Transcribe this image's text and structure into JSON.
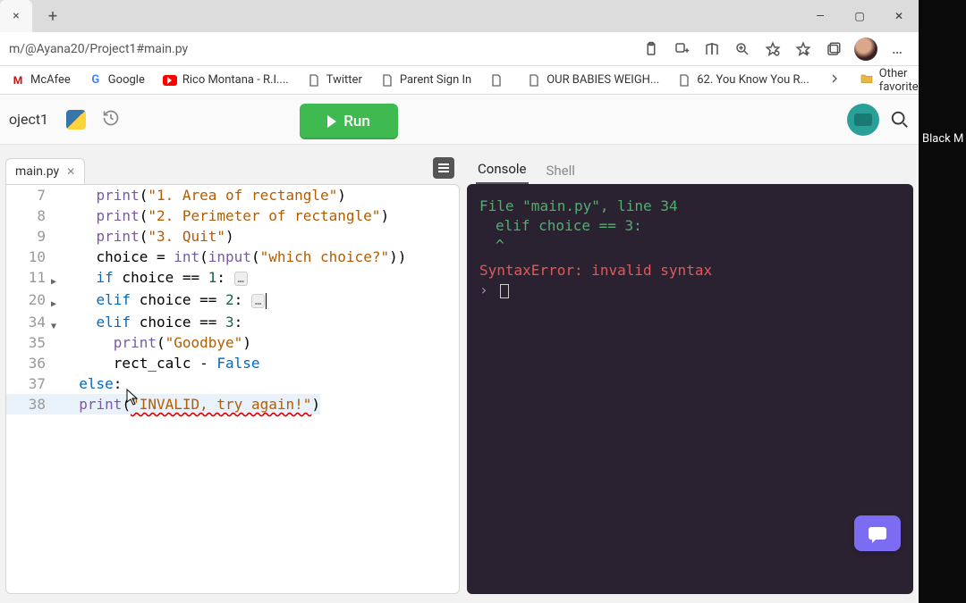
{
  "overlay": {
    "participant_label": "Black M"
  },
  "browser": {
    "close_tab": "×",
    "address": "m/@Ayana20/Project1#main.py",
    "window_controls": {
      "min": "—",
      "max": "▢",
      "close": "✕"
    },
    "addr_icons": {
      "clipboard": "clipboard-icon",
      "add_ext": "extensions-icon",
      "reader": "reader-icon",
      "zoom": "zoom-icon",
      "star": "favorite-star-icon",
      "star_plus": "collections-star-icon",
      "collections": "collections-icon",
      "more": "…"
    }
  },
  "bookmarks": {
    "items": [
      {
        "label": "McAfee",
        "icon": "mcafee"
      },
      {
        "label": "Google",
        "icon": "google"
      },
      {
        "label": "Rico Montana - R.I....",
        "icon": "youtube"
      },
      {
        "label": "Twitter",
        "icon": "page"
      },
      {
        "label": "Parent Sign In",
        "icon": "page"
      },
      {
        "label": "",
        "icon": "page"
      },
      {
        "label": "OUR BABIES WEIGH...",
        "icon": "page"
      },
      {
        "label": "62. You Know You R...",
        "icon": "page"
      }
    ],
    "other_label": "Other favorites"
  },
  "app_bar": {
    "project_name": "oject1",
    "run_label": "Run"
  },
  "editor": {
    "file_tab": "main.py",
    "lines": [
      {
        "num": "7",
        "fold": "",
        "tokens": [
          {
            "t": "    ",
            "c": ""
          },
          {
            "t": "print",
            "c": "fn"
          },
          {
            "t": "(",
            "c": ""
          },
          {
            "t": "\"1. Area of rectangle\"",
            "c": "str"
          },
          {
            "t": ")",
            "c": ""
          }
        ]
      },
      {
        "num": "8",
        "fold": "",
        "tokens": [
          {
            "t": "    ",
            "c": ""
          },
          {
            "t": "print",
            "c": "fn"
          },
          {
            "t": "(",
            "c": ""
          },
          {
            "t": "\"2. Perimeter of rectangle\"",
            "c": "str"
          },
          {
            "t": ")",
            "c": ""
          }
        ]
      },
      {
        "num": "9",
        "fold": "",
        "tokens": [
          {
            "t": "    ",
            "c": ""
          },
          {
            "t": "print",
            "c": "fn"
          },
          {
            "t": "(",
            "c": ""
          },
          {
            "t": "\"3. Quit\"",
            "c": "str"
          },
          {
            "t": ")",
            "c": ""
          }
        ]
      },
      {
        "num": "10",
        "fold": "",
        "tokens": [
          {
            "t": "    ",
            "c": ""
          },
          {
            "t": "choice = ",
            "c": ""
          },
          {
            "t": "int",
            "c": "fn"
          },
          {
            "t": "(",
            "c": ""
          },
          {
            "t": "input",
            "c": "fn"
          },
          {
            "t": "(",
            "c": ""
          },
          {
            "t": "\"which choice?\"",
            "c": "str"
          },
          {
            "t": "))",
            "c": ""
          }
        ]
      },
      {
        "num": "11",
        "fold": "▶",
        "tokens": [
          {
            "t": "    ",
            "c": ""
          },
          {
            "t": "if",
            "c": "kw"
          },
          {
            "t": " choice == ",
            "c": ""
          },
          {
            "t": "1",
            "c": "num"
          },
          {
            "t": ": ",
            "c": ""
          },
          {
            "t": "…",
            "c": "fold-dots"
          }
        ]
      },
      {
        "num": "20",
        "fold": "▶",
        "tokens": [
          {
            "t": "    ",
            "c": ""
          },
          {
            "t": "elif",
            "c": "kw"
          },
          {
            "t": " choice == ",
            "c": ""
          },
          {
            "t": "2",
            "c": "num"
          },
          {
            "t": ": ",
            "c": ""
          },
          {
            "t": "…",
            "c": "fold-dots"
          },
          {
            "t": "",
            "c": "caret"
          }
        ]
      },
      {
        "num": "34",
        "fold": "▼",
        "tokens": [
          {
            "t": "    ",
            "c": ""
          },
          {
            "t": "elif",
            "c": "kw"
          },
          {
            "t": " choice == ",
            "c": ""
          },
          {
            "t": "3",
            "c": "num"
          },
          {
            "t": ":",
            "c": ""
          }
        ]
      },
      {
        "num": "35",
        "fold": "",
        "tokens": [
          {
            "t": "      ",
            "c": ""
          },
          {
            "t": "print",
            "c": "fn"
          },
          {
            "t": "(",
            "c": ""
          },
          {
            "t": "\"Goodbye\"",
            "c": "str"
          },
          {
            "t": ")",
            "c": ""
          }
        ]
      },
      {
        "num": "36",
        "fold": "",
        "tokens": [
          {
            "t": "      rect_calc - ",
            "c": ""
          },
          {
            "t": "False",
            "c": "bool"
          }
        ]
      },
      {
        "num": "37",
        "fold": "",
        "tokens": [
          {
            "t": "  ",
            "c": ""
          },
          {
            "t": "else",
            "c": "kw"
          },
          {
            "t": ":",
            "c": ""
          }
        ]
      },
      {
        "num": "38",
        "fold": "",
        "tokens": [
          {
            "t": "  ",
            "c": ""
          },
          {
            "t": "print",
            "c": "fn"
          },
          {
            "t": "(",
            "c": ""
          },
          {
            "t": "\"INVALID, try again!\"",
            "c": "str err-underline"
          },
          {
            "t": ")",
            "c": ""
          }
        ]
      }
    ]
  },
  "console": {
    "tabs": {
      "console": "Console",
      "shell": "Shell"
    },
    "line1_a": "  File ",
    "line1_b": "\"main.py\"",
    "line1_c": ", line ",
    "line1_d": "34",
    "line2": "    elif choice == 3:",
    "line3": "    ^",
    "error": "SyntaxError: invalid syntax",
    "prompt": "› "
  }
}
